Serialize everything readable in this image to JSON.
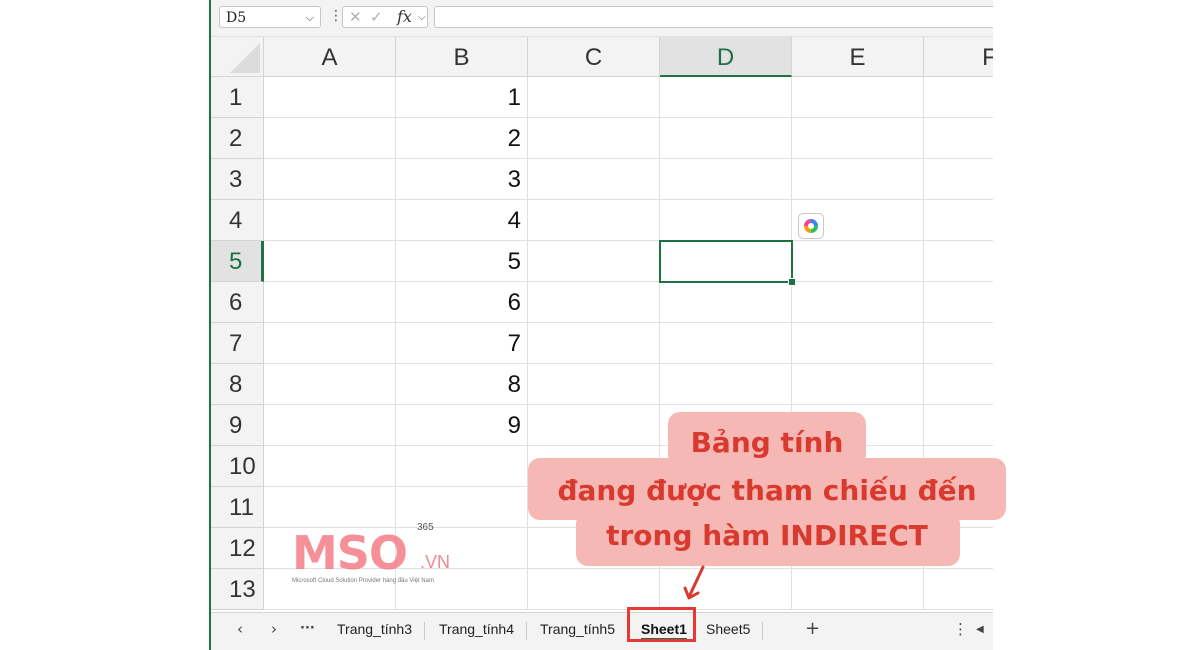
{
  "formula_bar": {
    "name_box": "D5",
    "cancel_icon": "close-icon",
    "confirm_icon": "check-icon",
    "fx_label": "fx",
    "formula": ""
  },
  "columns": [
    "A",
    "B",
    "C",
    "D",
    "E",
    "F"
  ],
  "active_column": "D",
  "rows": [
    "1",
    "2",
    "3",
    "4",
    "5",
    "6",
    "7",
    "8",
    "9",
    "10",
    "11",
    "12",
    "13"
  ],
  "active_row": "5",
  "column_b_values": [
    "1",
    "2",
    "3",
    "4",
    "5",
    "6",
    "7",
    "8",
    "9"
  ],
  "selected_cell": "D5",
  "sheet_tabs": {
    "items": [
      "Trang_tính3",
      "Trang_tính4",
      "Trang_tính5",
      "Sheet1",
      "Sheet5"
    ],
    "active": "Sheet1",
    "more": "···",
    "add": "+"
  },
  "callout": {
    "line1": "Bảng tính",
    "line2": "đang được tham chiếu đến",
    "line3": "trong hàm INDIRECT",
    "color": "#d93a2f",
    "background": "#f6b8b4"
  },
  "watermark": {
    "brand": "MSO",
    "suffix": ".VN",
    "superscript": "365",
    "tagline": "Microsoft Cloud Solution Provider hàng đầu Việt Nam"
  }
}
